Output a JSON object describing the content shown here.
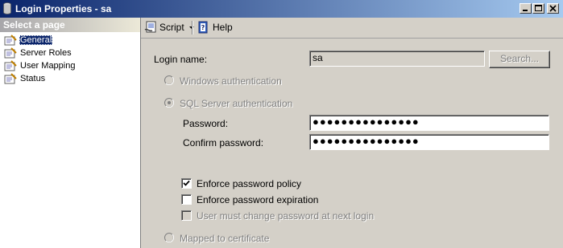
{
  "window": {
    "title": "Login Properties - sa"
  },
  "sidebar": {
    "header": "Select a page",
    "items": [
      {
        "label": "General",
        "selected": true
      },
      {
        "label": "Server Roles",
        "selected": false
      },
      {
        "label": "User Mapping",
        "selected": false
      },
      {
        "label": "Status",
        "selected": false
      }
    ]
  },
  "toolbar": {
    "script_label": "Script",
    "help_label": "Help"
  },
  "form": {
    "login_name_label": "Login name:",
    "login_name_value": "sa",
    "search_label": "Search...",
    "windows_auth_label": "Windows authentication",
    "sql_auth_label": "SQL Server authentication",
    "password_label": "Password:",
    "password_value": "●●●●●●●●●●●●●●●",
    "confirm_password_label": "Confirm password:",
    "confirm_password_value": "●●●●●●●●●●●●●●●",
    "enforce_policy_label": "Enforce password policy",
    "enforce_policy_checked": true,
    "enforce_expiration_label": "Enforce password expiration",
    "enforce_expiration_checked": false,
    "must_change_label": "User must change password at next login",
    "must_change_checked": false,
    "mapped_cert_label": "Mapped to certificate"
  }
}
